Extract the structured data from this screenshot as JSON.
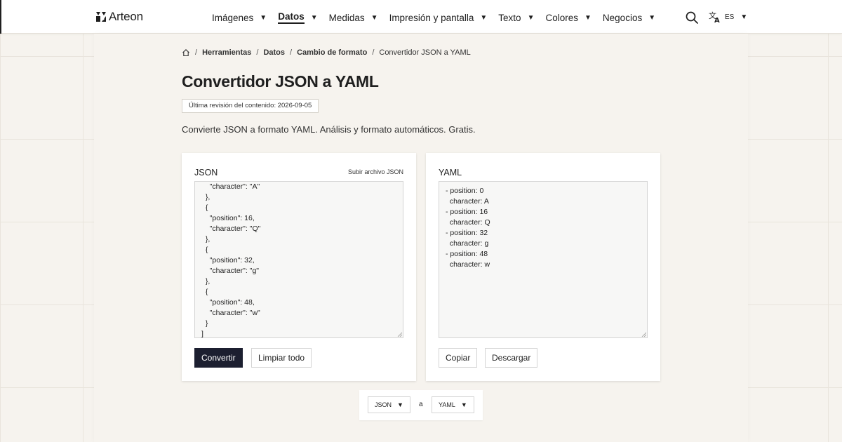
{
  "header": {
    "logo_text": "Arteon",
    "nav": [
      {
        "label": "Imágenes",
        "active": false
      },
      {
        "label": "Datos",
        "active": true
      },
      {
        "label": "Medidas",
        "active": false
      },
      {
        "label": "Impresión y pantalla",
        "active": false
      },
      {
        "label": "Texto",
        "active": false
      },
      {
        "label": "Colores",
        "active": false
      },
      {
        "label": "Negocios",
        "active": false
      }
    ],
    "search_icon": "search-icon",
    "language": {
      "icon": "translate-icon",
      "code": "ES"
    }
  },
  "breadcrumb": {
    "home_icon": "home-icon",
    "items": [
      "Herramientas",
      "Datos",
      "Cambio de formato"
    ],
    "current": "Convertidor JSON a YAML"
  },
  "page": {
    "title": "Convertidor JSON a YAML",
    "revision": "Última revisión del contenido: 2026-09-05",
    "description": "Convierte JSON a formato YAML. Análisis y formato automáticos. Gratis."
  },
  "input_panel": {
    "title": "JSON",
    "upload_label": "Subir archivo JSON",
    "content": "    \"character\": \"A\"\n  },\n  {\n    \"position\": 16,\n    \"character\": \"Q\"\n  },\n  {\n    \"position\": 32,\n    \"character\": \"g\"\n  },\n  {\n    \"position\": 48,\n    \"character\": \"w\"\n  }\n]",
    "convert_label": "Convertir",
    "clear_label": "Limpiar todo"
  },
  "output_panel": {
    "title": "YAML",
    "content": "- position: 0\n  character: A\n- position: 16\n  character: Q\n- position: 32\n  character: g\n- position: 48\n  character: w",
    "copy_label": "Copiar",
    "download_label": "Descargar"
  },
  "format_bar": {
    "from": "JSON",
    "separator": "a",
    "to": "YAML"
  },
  "colors": {
    "background": "#f6f3ee",
    "primary_button": "#1c1f30",
    "text": "#1f1f1f"
  }
}
